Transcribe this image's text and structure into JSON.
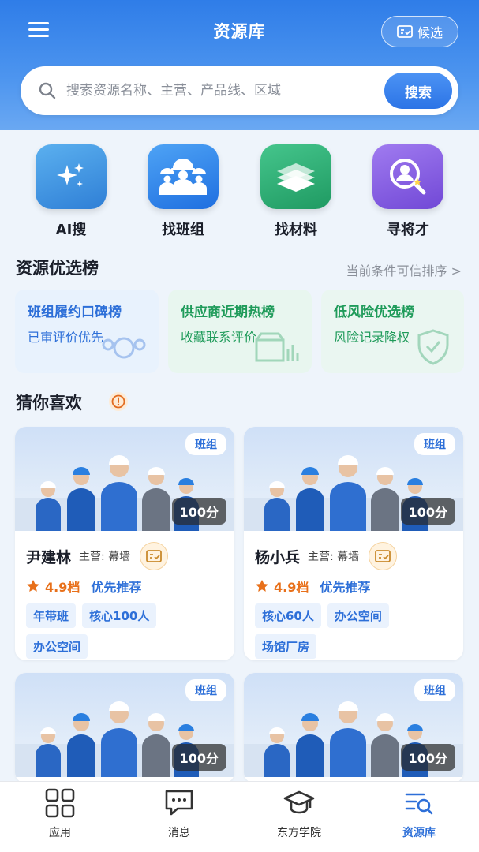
{
  "header": {
    "title": "资源库",
    "candidate_label": "候选"
  },
  "search": {
    "placeholder": "搜索资源名称、主营、产品线、区域",
    "button_label": "搜索"
  },
  "quick_actions": [
    {
      "label": "AI搜",
      "icon": "sparkle-icon",
      "color": "#3a8fe0"
    },
    {
      "label": "找班组",
      "icon": "workers-icon",
      "color": "#2f7be8"
    },
    {
      "label": "找材料",
      "icon": "materials-icon",
      "color": "#2fb07a"
    },
    {
      "label": "寻将才",
      "icon": "talent-search-icon",
      "color": "#8a5ae0"
    }
  ],
  "ranking": {
    "title": "资源优选榜",
    "more_label": "当前条件可信排序 >",
    "cards": [
      {
        "title": "班组履约口碑榜",
        "subtitle": "已审评价优先",
        "color": "#2d6fd8",
        "bg": "#e8f2fd"
      },
      {
        "title": "供应商近期热榜",
        "subtitle": "收藏联系评价",
        "color": "#1f9b5a",
        "bg": "#e8f6ef"
      },
      {
        "title": "低风险优选榜",
        "subtitle": "风险记录降权",
        "color": "#1f9b5a",
        "bg": "#eaf6f1"
      }
    ]
  },
  "recommend": {
    "title": "猜你喜欢",
    "cards": [
      {
        "type": "班组",
        "score": "100分",
        "name": "尹建林",
        "main_biz": "主营: 幕墙",
        "rating": "4.9档",
        "priority": "优先推荐",
        "tags": [
          "年带班",
          "核心100人",
          "办公空间"
        ]
      },
      {
        "type": "班组",
        "score": "100分",
        "name": "杨小兵",
        "main_biz": "主营: 幕墙",
        "rating": "4.9档",
        "priority": "优先推荐",
        "tags": [
          "核心60人",
          "办公空间",
          "场馆厂房"
        ]
      },
      {
        "type": "班组",
        "score": "100分"
      },
      {
        "type": "班组",
        "score": "100分"
      }
    ]
  },
  "nav": {
    "items": [
      {
        "label": "应用",
        "icon": "grid-icon"
      },
      {
        "label": "消息",
        "icon": "message-icon"
      },
      {
        "label": "东方学院",
        "icon": "graduation-cap-icon"
      },
      {
        "label": "资源库",
        "icon": "resource-library-icon",
        "active": true
      }
    ]
  }
}
